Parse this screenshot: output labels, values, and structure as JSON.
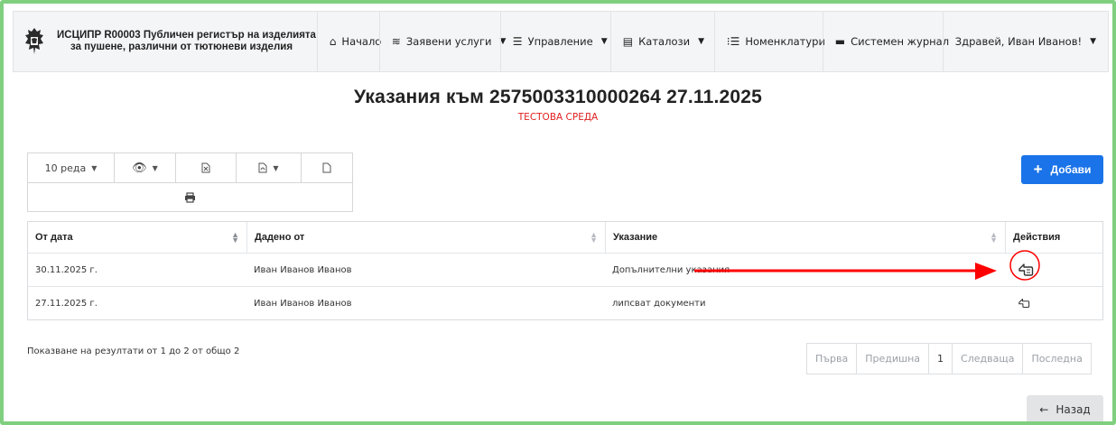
{
  "brand": {
    "line1": "ИСЦИПР R00003 Публичен регистър на изделията",
    "line2": "за пушене, различни от тютюневи изделия"
  },
  "nav": [
    {
      "label": "Начало",
      "icon": "home-icon",
      "glyph": "🏠",
      "dropdown": false
    },
    {
      "label": "Заявени услуги",
      "icon": "layers-icon",
      "glyph": "☰",
      "dropdown": true
    },
    {
      "label": "Управление",
      "icon": "sliders-icon",
      "glyph": "☰",
      "dropdown": true
    },
    {
      "label": "Каталози",
      "icon": "catalog-icon",
      "glyph": "▤",
      "dropdown": true
    },
    {
      "label": "Номенклатури",
      "icon": "list-icon",
      "glyph": "☷",
      "dropdown": false
    },
    {
      "label": "Системен журнал",
      "icon": "journal-icon",
      "glyph": "▤",
      "dropdown": false
    }
  ],
  "user": {
    "greeting": "Здравей, Иван Иванов!"
  },
  "page": {
    "title": "Указания към 2575003310000264 27.11.2025",
    "environment": "ТЕСТОВА СРЕДА"
  },
  "toolbar": {
    "rows_label": "10 реда",
    "add_label": "Добави"
  },
  "table": {
    "columns": [
      "От дата",
      "Дадено от",
      "Указание",
      "Действия"
    ],
    "rows": [
      {
        "date": "30.11.2025 г.",
        "by": "Иван Иванов Иванов",
        "note": "Допълнителни указания"
      },
      {
        "date": "27.11.2025 г.",
        "by": "Иван Иванов Иванов",
        "note": "липсват документи"
      }
    ]
  },
  "summary": "Показване на резултати от 1 до 2 от общо 2",
  "pager": {
    "first": "Първа",
    "prev": "Предишна",
    "current": "1",
    "next": "Следваща",
    "last": "Последна"
  },
  "back_label": "Назад",
  "colors": {
    "accent": "#1a73e8",
    "env_text": "#e02020",
    "annotation": "#ff0000",
    "frame": "#7fcf7f"
  }
}
